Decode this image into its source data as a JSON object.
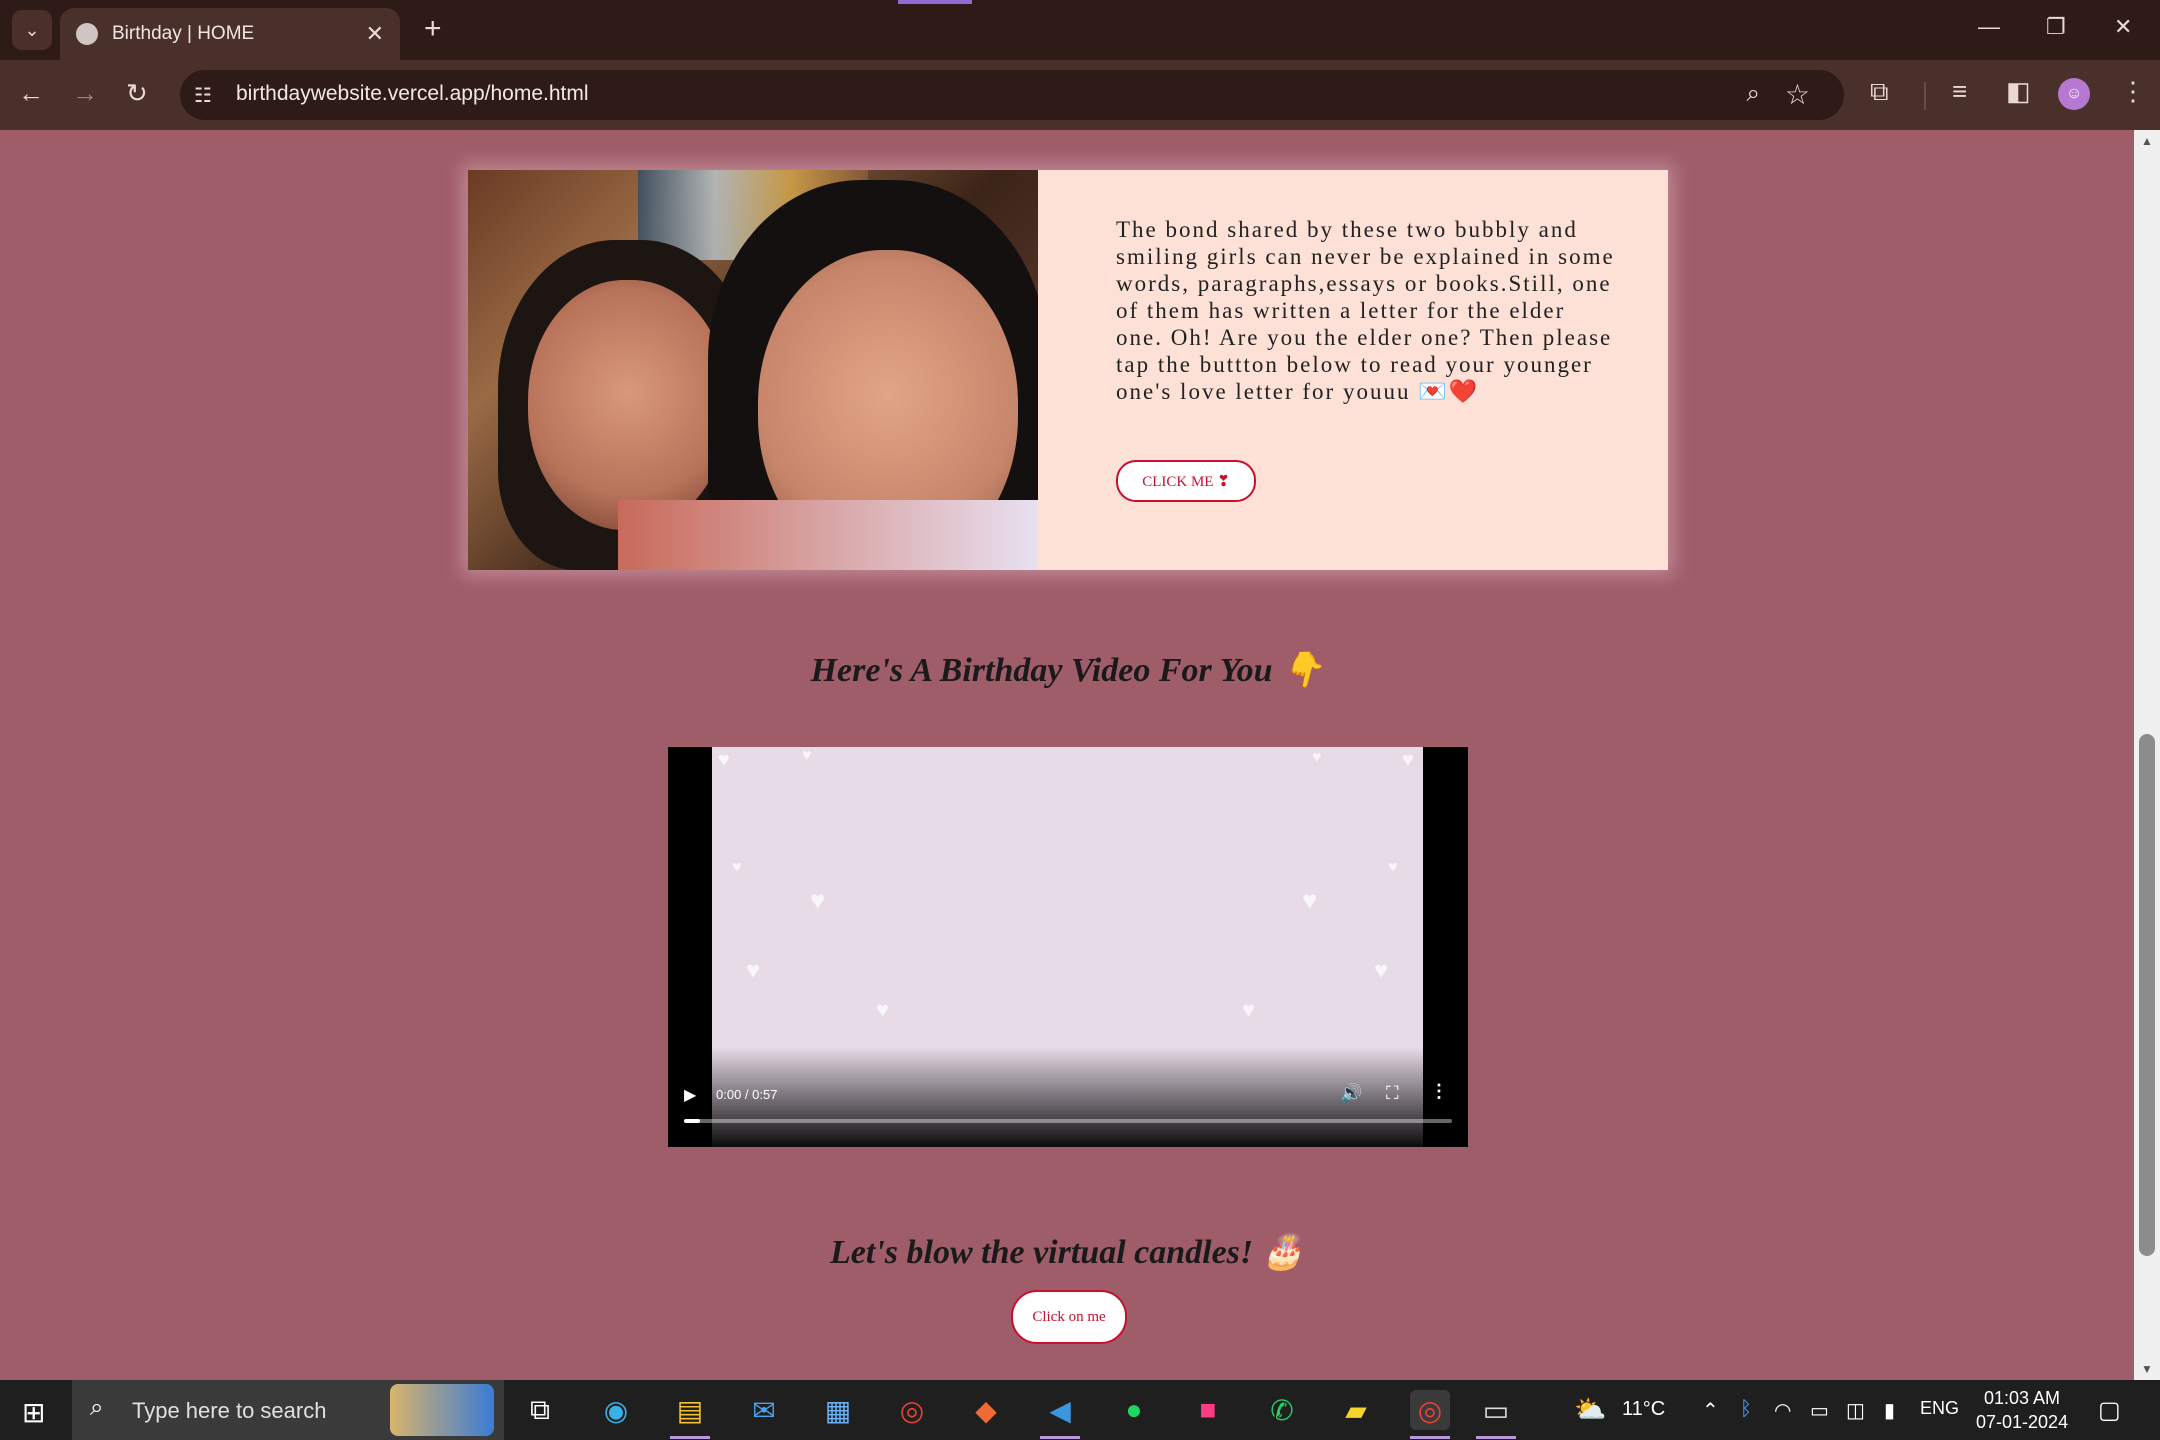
{
  "browser": {
    "tab_title": "Birthday | HOME",
    "url": "birthdaywebsite.vercel.app/home.html"
  },
  "page": {
    "card_text": "The bond shared by these two bubbly and smiling girls can never be explained in some words, paragraphs,essays or books.Still, one of them has written a letter for the elder one. Oh! Are you the elder one? Then please tap the buttton below to read your younger one's love letter for youuu 💌❤️",
    "click_me_label": "CLICK ME ❣",
    "video_heading": "Here's A Birthday Video For You 👇",
    "video_time": "0:00 / 0:57",
    "video_progress": 0.0,
    "candle_heading": "Let's blow the virtual candles! 🎂",
    "click_on_me_label": "Click on me"
  },
  "taskbar": {
    "search_placeholder": "Type here to search",
    "temperature": "11°C",
    "language": "ENG",
    "time": "01:03 AM",
    "date": "07-01-2024"
  },
  "colors": {
    "page_bg": "#9f5c69",
    "card_bg": "#fde0d6",
    "button_accent": "#c8102e"
  }
}
